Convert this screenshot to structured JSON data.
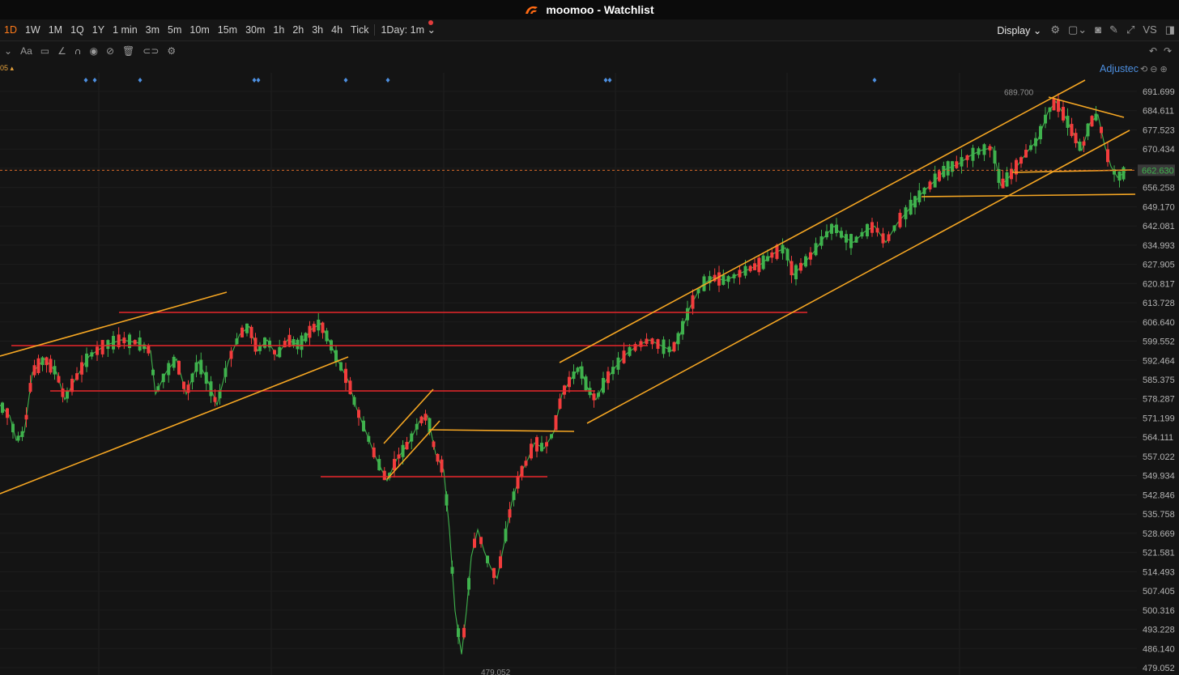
{
  "window": {
    "title": "moomoo - Watchlist"
  },
  "toolbar": {
    "periods": [
      "1D",
      "1W",
      "1M",
      "1Q",
      "1Y",
      "1 min",
      "3m",
      "5m",
      "10m",
      "15m",
      "30m",
      "1h",
      "2h",
      "3h",
      "4h",
      "Tick"
    ],
    "active_period": "1D",
    "interval_select": "1Day: 1m ⌄",
    "display_label": "Display",
    "right_text": "VS"
  },
  "drawing_tools": [
    "text-tool",
    "comment-tool",
    "line-tool",
    "magnet-tool",
    "eye-tool",
    "hide-tool",
    "trash-tool",
    "link-tool",
    "settings-tool"
  ],
  "chart_header": {
    "adjusted_label": "Adjustec",
    "indicator_label": "05"
  },
  "chart_data": {
    "type": "candlestick",
    "axis_ticks": [
      "691.699",
      "684.611",
      "677.523",
      "670.434",
      "663.346",
      "656.258",
      "649.170",
      "642.081",
      "634.993",
      "627.905",
      "620.817",
      "613.728",
      "606.640",
      "599.552",
      "592.464",
      "585.375",
      "578.287",
      "571.199",
      "564.111",
      "557.022",
      "549.934",
      "542.846",
      "535.758",
      "528.669",
      "521.581",
      "514.493",
      "507.405",
      "500.316",
      "493.228",
      "486.140",
      "479.052"
    ],
    "current_price": "662.630",
    "high_label": "689.700",
    "low_label": "479.052",
    "ylim": [
      479.052,
      691.699
    ]
  },
  "colors": {
    "up": "#3fb24d",
    "down": "#f23c3c",
    "trend_orange": "#f5a623",
    "level_red": "#e8262b",
    "accent": "#ff7a1a",
    "link_blue": "#4d8fe0"
  }
}
